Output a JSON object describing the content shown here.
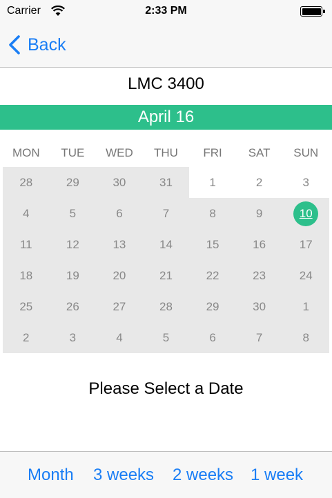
{
  "status_bar": {
    "carrier": "Carrier",
    "time": "2:33 PM"
  },
  "nav": {
    "back_label": "Back"
  },
  "course_title": "LMC 3400",
  "month_label": "April 16",
  "weekdays": [
    "MON",
    "TUE",
    "WED",
    "THU",
    "FRI",
    "SAT",
    "SUN"
  ],
  "weeks": [
    [
      "28",
      "29",
      "30",
      "31",
      "1",
      "2",
      "3"
    ],
    [
      "4",
      "5",
      "6",
      "7",
      "8",
      "9",
      "10"
    ],
    [
      "11",
      "12",
      "13",
      "14",
      "15",
      "16",
      "17"
    ],
    [
      "18",
      "19",
      "20",
      "21",
      "22",
      "23",
      "24"
    ],
    [
      "25",
      "26",
      "27",
      "28",
      "29",
      "30",
      "1"
    ],
    [
      "2",
      "3",
      "4",
      "5",
      "6",
      "7",
      "8"
    ]
  ],
  "selected_day": "10",
  "prompt": "Please Select a Date",
  "view_options": [
    "Month",
    "3 weeks",
    "2 weeks",
    "1 week"
  ],
  "colors": {
    "accent": "#2dbf8b",
    "link": "#1a7ef5",
    "shade": "#e8e8e8"
  },
  "icons": {
    "back": "chevron-left-icon",
    "wifi": "wifi-icon",
    "battery": "battery-icon"
  }
}
